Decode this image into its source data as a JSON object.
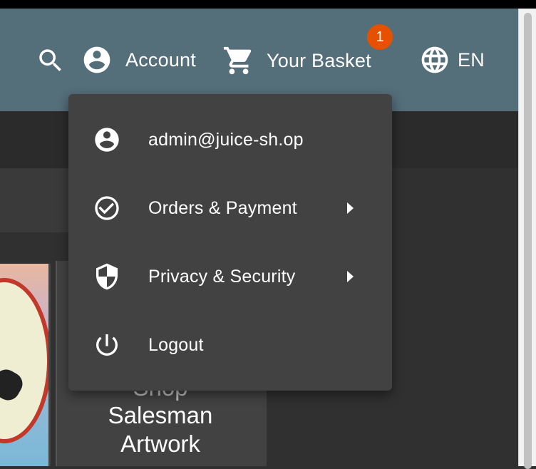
{
  "toolbar": {
    "account_label": "Account",
    "basket_label": "Your Basket",
    "basket_count": "1",
    "language_label": "EN",
    "icons": [
      "search-icon",
      "account-circle-icon",
      "cart-icon",
      "globe-icon"
    ]
  },
  "menu": {
    "items": [
      {
        "label": "admin@juice-sh.op",
        "icon": "account-circle-icon"
      },
      {
        "label": "Orders & Payment",
        "icon": "check-circle-icon"
      },
      {
        "label": "Privacy & Security",
        "icon": "shield-icon"
      },
      {
        "label": "Logout",
        "icon": "power-icon"
      }
    ]
  },
  "product": {
    "title_line1": "Shop",
    "title_line2": "Salesman",
    "title_line3": "Artwork"
  },
  "colors": {
    "toolbar": "#546e7a",
    "badge": "#e65100",
    "menu_bg": "#424242",
    "background": "#303030"
  }
}
